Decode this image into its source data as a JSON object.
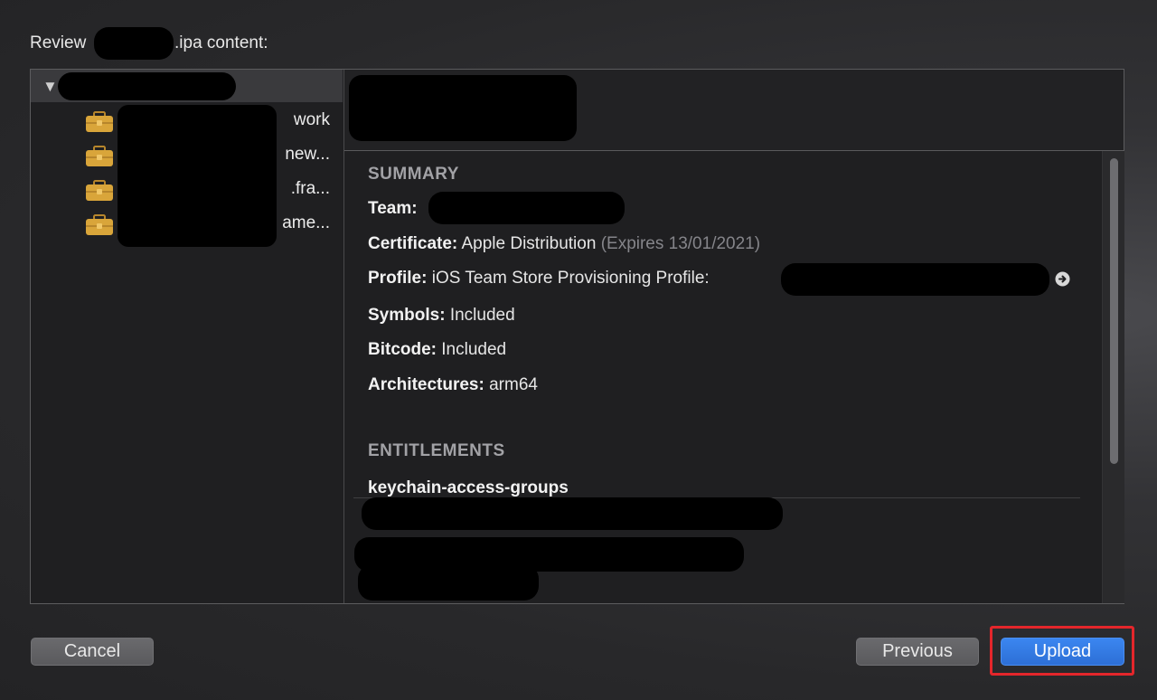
{
  "header": {
    "title_prefix": "Review",
    "title_suffix": ".ipa content:"
  },
  "sidebar": {
    "root_expanded_glyph": "▼",
    "items": [
      {
        "icon": "briefcase-icon",
        "label_tail": "work"
      },
      {
        "icon": "briefcase-icon",
        "label_tail": "new..."
      },
      {
        "icon": "briefcase-icon",
        "label_tail": ".fra..."
      },
      {
        "icon": "briefcase-icon",
        "label_tail": "ame..."
      }
    ]
  },
  "details": {
    "summary_heading": "SUMMARY",
    "team_label": "Team:",
    "certificate_label": "Certificate:",
    "certificate_value": "Apple Distribution",
    "certificate_expiry": "(Expires 13/01/2021)",
    "profile_label": "Profile:",
    "profile_value": "iOS Team Store Provisioning Profile:",
    "symbols_label": "Symbols:",
    "symbols_value": "Included",
    "bitcode_label": "Bitcode:",
    "bitcode_value": "Included",
    "architectures_label": "Architectures:",
    "architectures_value": "arm64",
    "entitlements_heading": "ENTITLEMENTS",
    "entitlement_key": "keychain-access-groups"
  },
  "buttons": {
    "cancel": "Cancel",
    "previous": "Previous",
    "upload": "Upload"
  },
  "colors": {
    "accent_blue": "#2d6fd6",
    "highlight_red": "#e4262b",
    "briefcase_gold": "#d9a53a"
  }
}
